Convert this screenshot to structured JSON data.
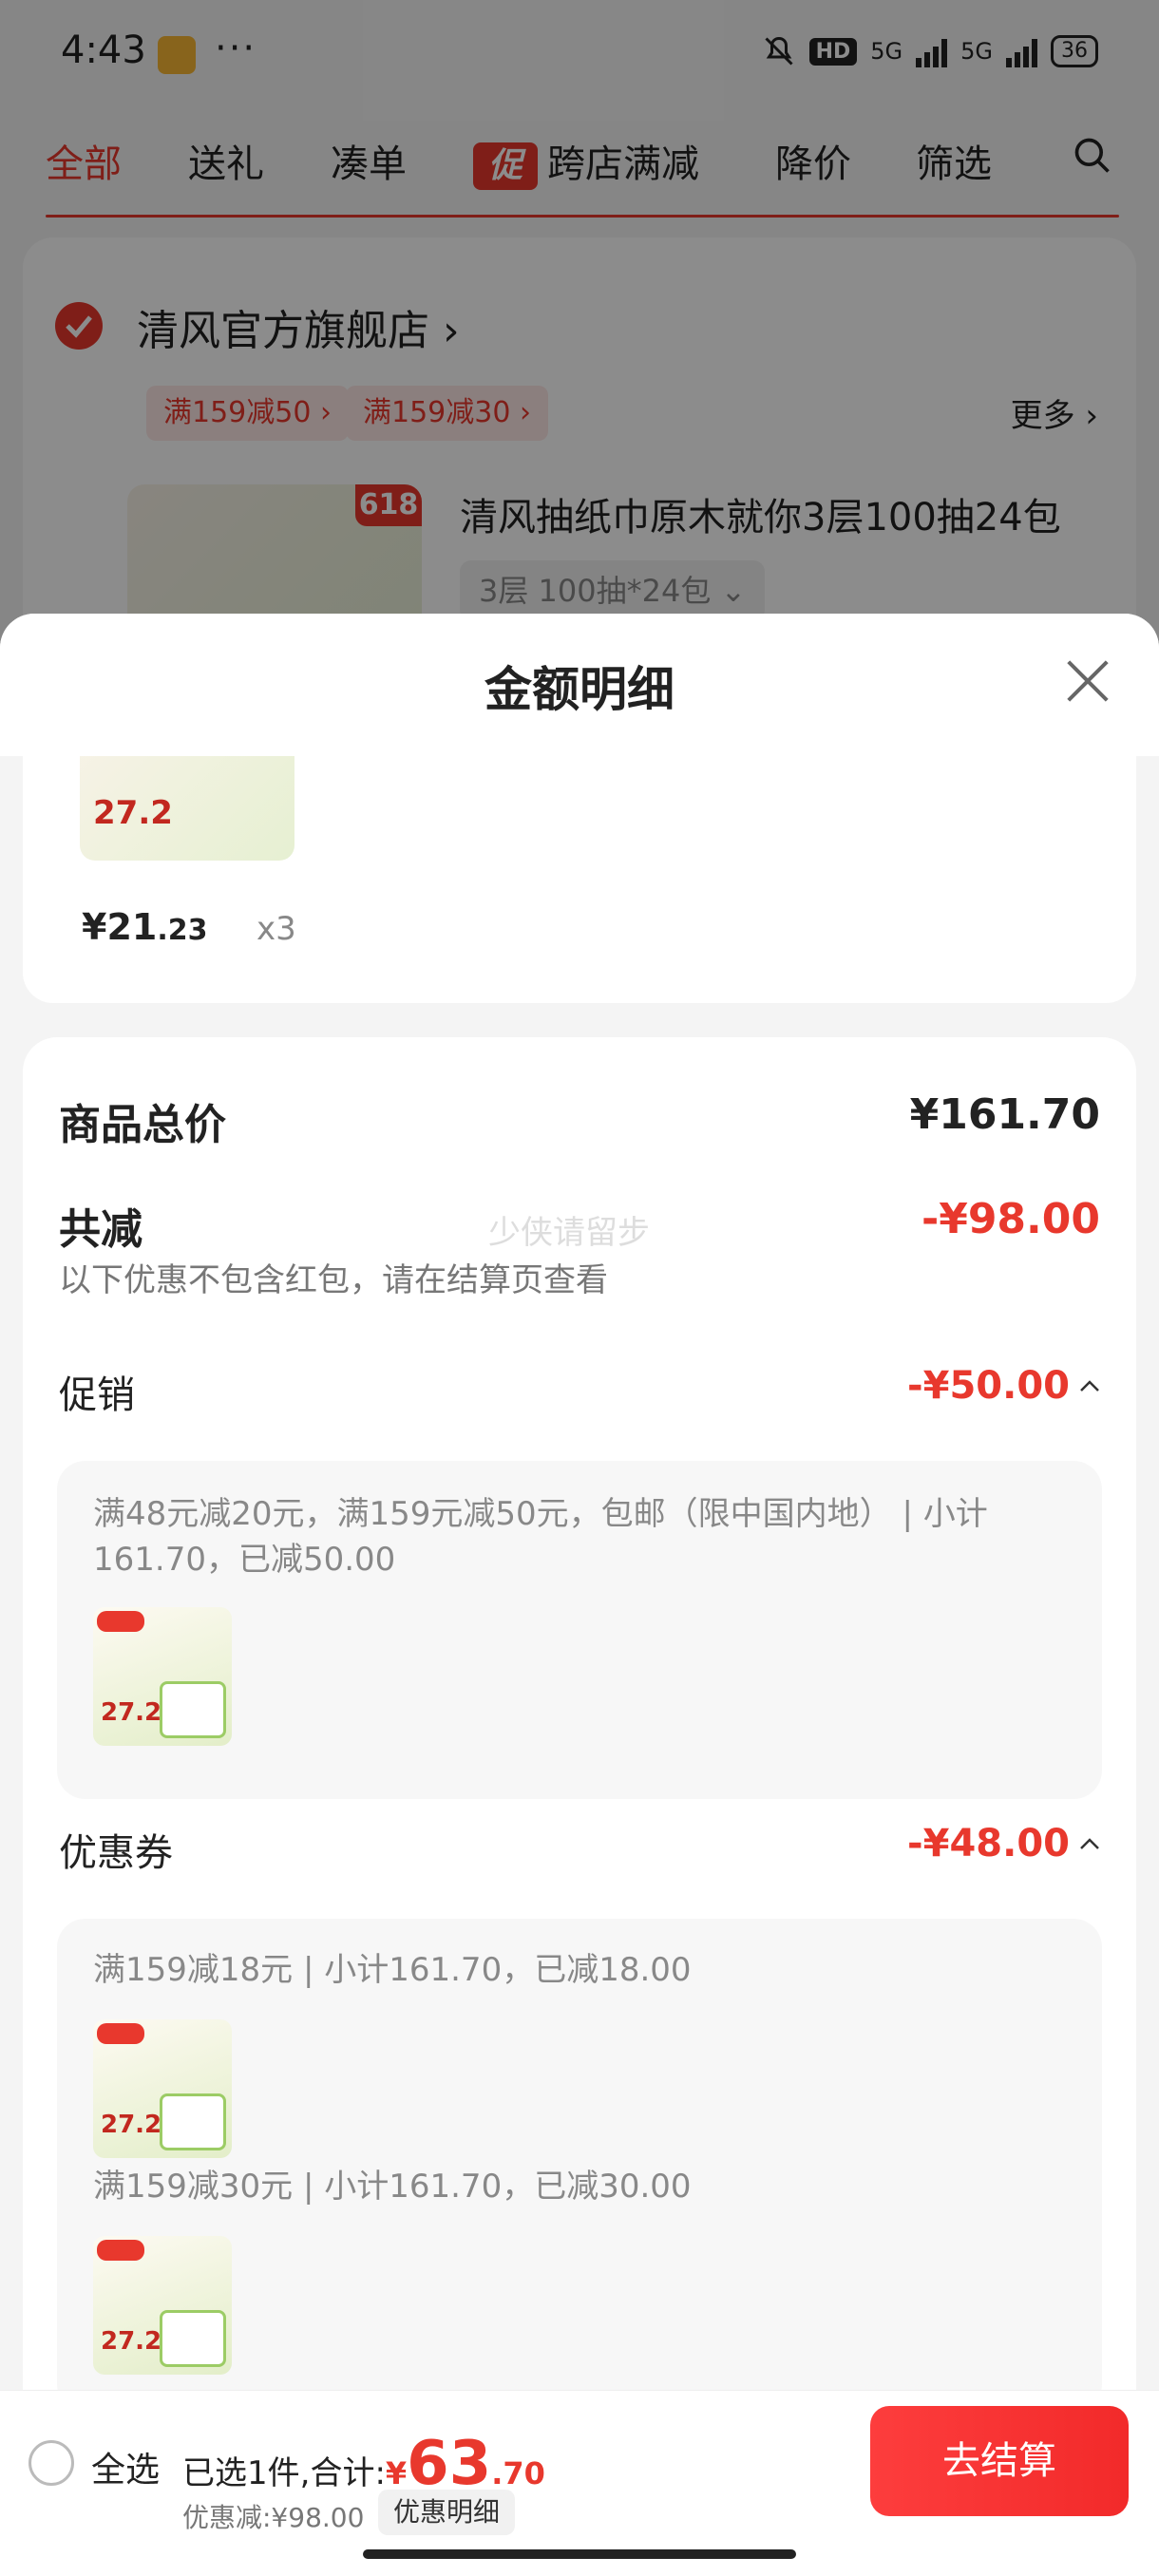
{
  "status_bar": {
    "time": "4:43",
    "dots": "···",
    "hd": "HD",
    "net1": "5G",
    "net2": "5G",
    "battery": "36"
  },
  "tabs": {
    "all": "全部",
    "gift": "送礼",
    "combine": "凑单",
    "promo_badge": "促",
    "cross_store": "跨店满减",
    "price_drop": "降价",
    "filter": "筛选"
  },
  "store": {
    "name": "清风官方旗舰店",
    "coupon1": "满159减50",
    "coupon2": "满159减30",
    "more": "更多",
    "product_title": "清风抽纸巾原木就你3层100抽24包",
    "spec": "3层 100抽*24包",
    "tag": "618"
  },
  "sheet": {
    "title": "金额明细",
    "item_price_main": "¥21",
    "item_price_cents": ".23",
    "item_qty": "x3",
    "total_label": "商品总价",
    "total_value": "¥161.70",
    "reduce_label": "共减",
    "reduce_value": "-¥98.00",
    "note": "以下优惠不包含红包，请在结算页查看",
    "watermark": "少侠请留步",
    "promo_label": "促销",
    "promo_value": "-¥50.00",
    "promo_detail": "满48元减20元，满159元减50元，包邮（限中国内地） | 小计161.70，已减50.00",
    "coupon_label": "优惠券",
    "coupon_value": "-¥48.00",
    "coupon_detail1": "满159减18元 | 小计161.70，已减18.00",
    "coupon_detail2": "满159减30元 | 小计161.70，已减30.00",
    "thumb_price": "27.2"
  },
  "bottom": {
    "select_all": "全选",
    "selected_text": "已选1件,合计:",
    "yen": "¥",
    "amount_int": "63",
    "amount_cents": ".70",
    "saved": "优惠减:¥98.00",
    "detail_chip": "优惠明细",
    "checkout": "去结算"
  },
  "colors": {
    "accent": "#e8382d",
    "checkout_bg": "#f22a2a"
  }
}
